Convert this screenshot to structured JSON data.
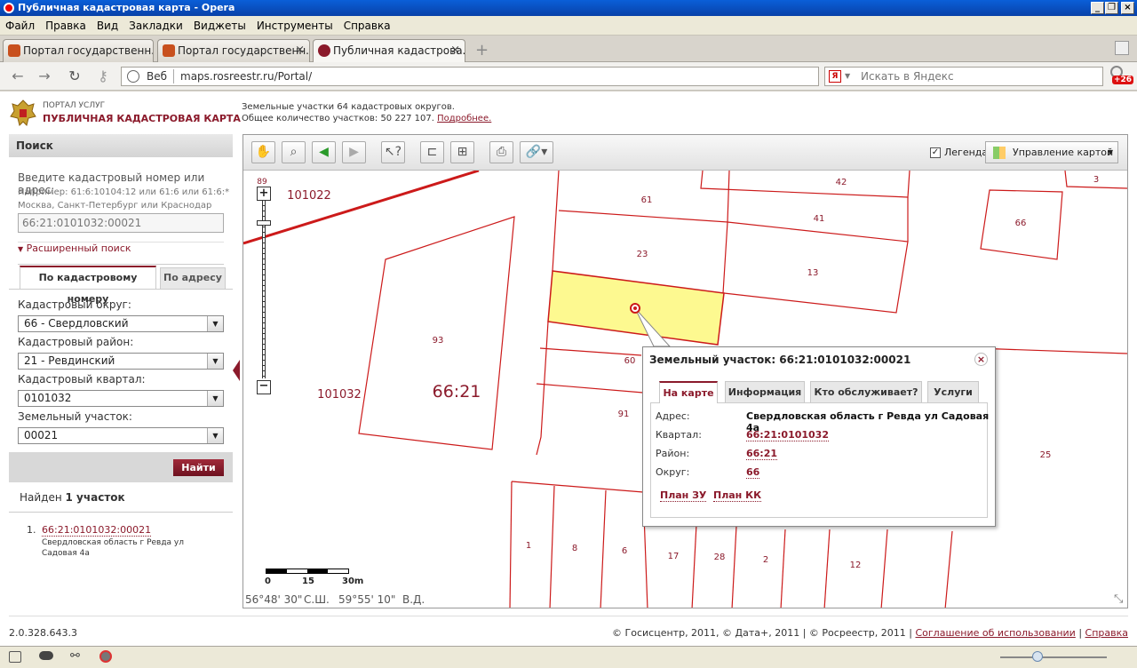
{
  "window": {
    "title": "Публичная кадастровая карта - Opera"
  },
  "menu": [
    "Файл",
    "Правка",
    "Вид",
    "Закладки",
    "Виджеты",
    "Инструменты",
    "Справка"
  ],
  "tabs": [
    {
      "label": "Портал государственн..."
    },
    {
      "label": "Портал государственн..."
    },
    {
      "label": "Публичная кадастрова..."
    }
  ],
  "address": {
    "web_label": "Веб",
    "url": "maps.rosreestr.ru/Portal/",
    "search_placeholder": "Искать в Яндекс",
    "badge": "+26"
  },
  "header": {
    "portal_small": "ПОРТАЛ УСЛУГ",
    "portal_title": "ПУБЛИЧНАЯ КАДАСТРОВАЯ КАРТА",
    "info_line1": "Земельные участки 64 кадастровых округов.",
    "info_line2": "Общее количество участков: 50 227 107.",
    "info_more": "Подробнее."
  },
  "search": {
    "title": "Поиск",
    "prompt": "Введите кадастровый номер или адрес:",
    "example1": "Например: 61:6:10104:12 или 61:6 или 61:6:*",
    "example2": "Москва, Санкт-Петербург или Краснодар",
    "input_value": "66:21:0101032:00021",
    "advanced": "Расширенный поиск",
    "tab_number": "По кадастровому номеру",
    "tab_address": "По адресу",
    "okrug_label": "Кадастровый округ:",
    "okrug_value": "66 - Свердловский",
    "rayon_label": "Кадастровый район:",
    "rayon_value": "21 - Ревдинский",
    "kvartal_label": "Кадастровый квартал:",
    "kvartal_value": "0101032",
    "uchastok_label": "Земельный участок:",
    "uchastok_value": "00021",
    "find_button": "Найти"
  },
  "results": {
    "found_prefix": "Найден",
    "found_bold": "1 участок",
    "items": [
      {
        "num": "1.",
        "link": "66:21:0101032:00021",
        "addr1": "Свердловская область г Ревда ул",
        "addr2": "Садовая 4а"
      }
    ]
  },
  "map_toolbar": {
    "legend_label": "Легенда",
    "manage_label": "Управление картой"
  },
  "map_labels": {
    "quarter1": "101022",
    "quarter2": "101032",
    "district": "66:21",
    "zoom_top": "89",
    "parcels": [
      "61",
      "42",
      "3",
      "41",
      "66",
      "23",
      "13",
      "93",
      "60",
      "91",
      "25",
      "1",
      "8",
      "6",
      "17",
      "28",
      "2",
      "12"
    ]
  },
  "scale": {
    "marks": [
      "0",
      "15",
      "30m"
    ],
    "coords": [
      "56°48' 30\"",
      "С.Ш.",
      "59°55' 10\"",
      "В.Д."
    ]
  },
  "popup": {
    "title": "Земельный участок: 66:21:0101032:00021",
    "tabs": [
      "На карте",
      "Информация",
      "Кто обслуживает?",
      "Услуги"
    ],
    "rows": [
      {
        "k": "Адрес:",
        "v": "Свердловская область г Ревда ул Садовая 4а"
      },
      {
        "k": "Квартал:",
        "v": "66:21:0101032"
      },
      {
        "k": "Район:",
        "v": "66:21"
      },
      {
        "k": "Округ:",
        "v": "66"
      }
    ],
    "links": [
      "План ЗУ",
      "План КК"
    ]
  },
  "footer": {
    "version": "2.0.328.643.3",
    "copyright": "© Госисцентр, 2011, © Дата+, 2011 | © Росреестр, 2011 |",
    "terms": "Соглашение об использовании",
    "help": "Справка"
  },
  "colors": {
    "accent": "#8b1a2b",
    "highlight": "#fdf990",
    "parcel_line": "#cc1a1a"
  }
}
